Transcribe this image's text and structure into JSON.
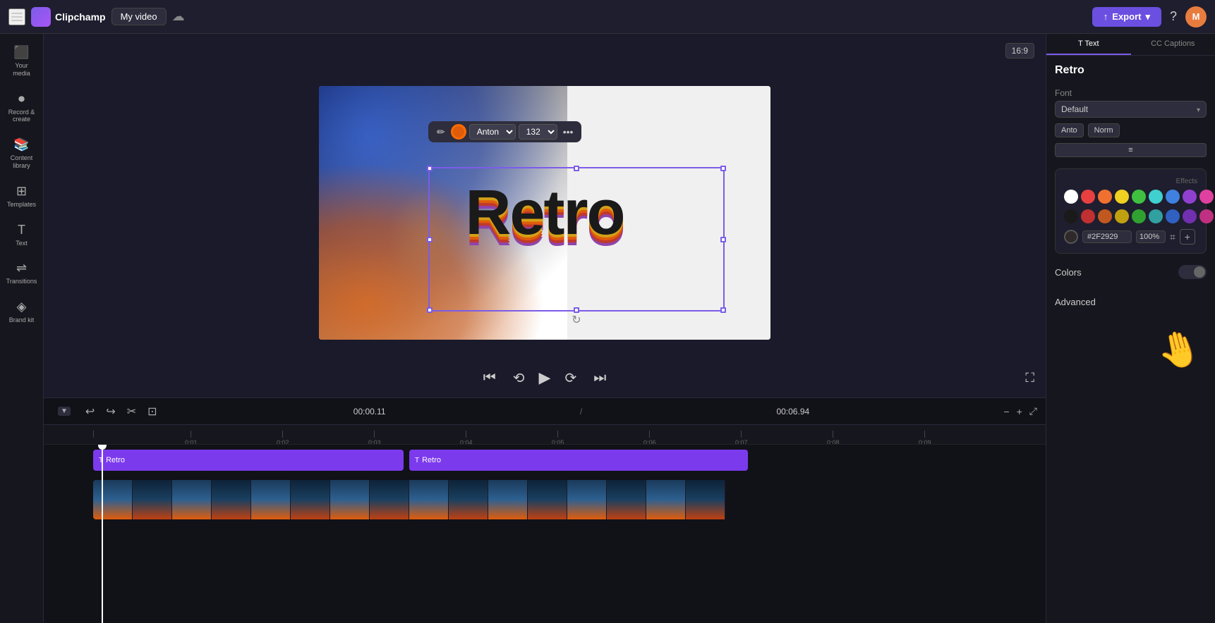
{
  "app": {
    "name": "Clipchamp",
    "project_name": "My video"
  },
  "topbar": {
    "export_label": "Export",
    "help_label": "?",
    "avatar_initials": "M"
  },
  "sidebar": {
    "items": [
      {
        "id": "your-media",
        "label": "Your media",
        "icon": "⬛"
      },
      {
        "id": "record-create",
        "label": "Record & create",
        "icon": "⏺"
      },
      {
        "id": "content-library",
        "label": "Content library",
        "icon": "📚"
      },
      {
        "id": "templates",
        "label": "Templates",
        "icon": "⊞"
      },
      {
        "id": "text",
        "label": "Text",
        "icon": "T"
      },
      {
        "id": "transitions",
        "label": "Transitions",
        "icon": "⟷"
      },
      {
        "id": "brand-kit",
        "label": "Brand kit",
        "icon": "◈"
      }
    ]
  },
  "canvas": {
    "aspect_ratio": "16:9",
    "preview_text": "Retro"
  },
  "text_toolbar": {
    "font_name": "Anton",
    "font_size": "132"
  },
  "video_controls": {
    "current_time": "00:00.11",
    "total_time": "00:06.94"
  },
  "timeline": {
    "toolbar": {
      "time_display": "00:00.11 / 00:06.94"
    },
    "ruler_marks": [
      "0:01",
      "0:02",
      "0:03",
      "0:04",
      "0:05",
      "0:06",
      "0:07",
      "0:08",
      "0:09"
    ],
    "text_tracks": [
      {
        "label": "Retro",
        "start_pct": 0,
        "width_pct": 40
      },
      {
        "label": "Retro",
        "start_pct": 41,
        "width_pct": 59
      }
    ]
  },
  "right_panel": {
    "title": "Retro",
    "tabs": [
      {
        "id": "text",
        "label": "Text",
        "active": true
      },
      {
        "id": "captions",
        "label": "Captions"
      }
    ],
    "font_section": {
      "label": "Font",
      "style_dropdown": "Default",
      "font_name": "Anto",
      "style_label": "Norm"
    },
    "colors_section": {
      "label": "Colors"
    },
    "advanced_section": {
      "label": "Advanced"
    },
    "effects_label": "Effects",
    "color_swatches_row1": [
      {
        "color": "#ffffff",
        "label": "white"
      },
      {
        "color": "#e84040",
        "label": "red"
      },
      {
        "color": "#f07030",
        "label": "orange"
      },
      {
        "color": "#f0d020",
        "label": "yellow"
      },
      {
        "color": "#40c040",
        "label": "green"
      },
      {
        "color": "#40d0d0",
        "label": "teal"
      },
      {
        "color": "#4080e0",
        "label": "blue"
      },
      {
        "color": "#9040d0",
        "label": "purple"
      },
      {
        "color": "#e040a0",
        "label": "pink"
      }
    ],
    "color_swatches_row2": [
      {
        "color": "#1a1a1a",
        "label": "black"
      },
      {
        "color": "#c03030",
        "label": "dark-red"
      },
      {
        "color": "#c05820",
        "label": "dark-orange"
      },
      {
        "color": "#c0a010",
        "label": "dark-yellow"
      },
      {
        "color": "#30a030",
        "label": "dark-green"
      },
      {
        "color": "#30a0a0",
        "label": "dark-teal"
      },
      {
        "color": "#3060c0",
        "label": "dark-blue"
      },
      {
        "color": "#7030b0",
        "label": "dark-purple"
      },
      {
        "color": "#c03080",
        "label": "dark-pink"
      }
    ],
    "hex_value": "#2F2929",
    "opacity_value": "100%"
  }
}
